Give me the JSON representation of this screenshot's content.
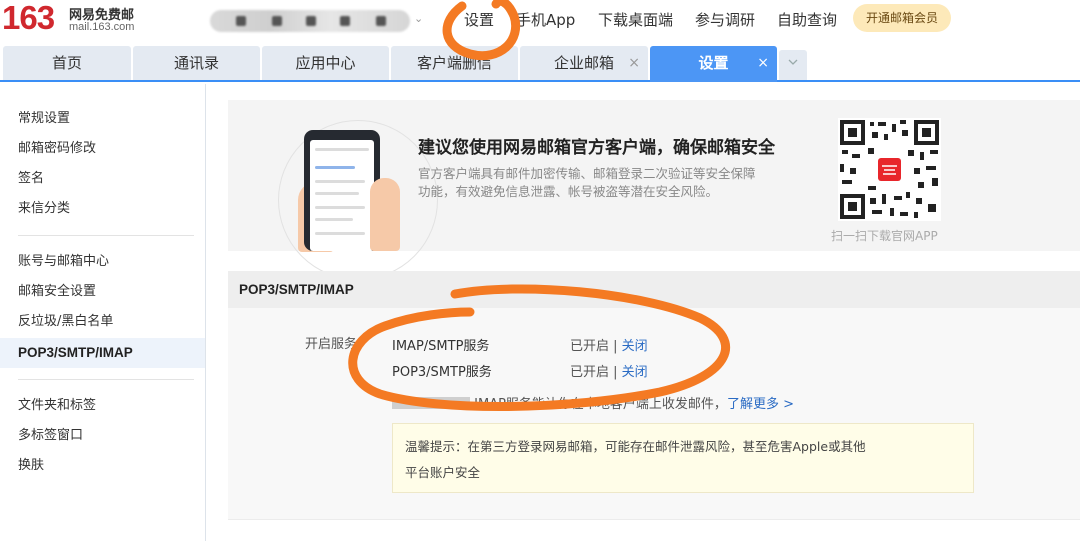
{
  "brand": {
    "number": "163",
    "name": "网易免费邮",
    "domain": "mail.163.com",
    "color": "#d0282e"
  },
  "topnav": {
    "settings": "设置",
    "mobile_app": "手机App",
    "desktop": "下载桌面端",
    "survey": "参与调研",
    "self_service": "自助查询",
    "vip": "开通邮箱会员",
    "caret": "⌄"
  },
  "tabs": [
    {
      "label": "首页"
    },
    {
      "label": "通讯录"
    },
    {
      "label": "应用中心"
    },
    {
      "label": "客户端删信"
    },
    {
      "label": "企业邮箱",
      "close": "×"
    },
    {
      "label": "设置",
      "close": "×",
      "active": true
    }
  ],
  "tab_more_icon": "chevron-down-icon",
  "sidebar": {
    "groups": [
      [
        "常规设置",
        "邮箱密码修改",
        "签名",
        "来信分类"
      ],
      [
        "账号与邮箱中心",
        "邮箱安全设置",
        "反垃圾/黑白名单",
        "POP3/SMTP/IMAP"
      ],
      [
        "文件夹和标签",
        "多标签窗口",
        "换肤"
      ]
    ],
    "active": "POP3/SMTP/IMAP"
  },
  "banner": {
    "title": "建议您使用网易邮箱官方客户端，确保邮箱安全",
    "desc": "官方客户端具有邮件加密传输、邮箱登录二次验证等安全保障功能，有效避免信息泄露、帐号被盗等潜在安全风险。",
    "qr_caption": "扫一扫下载官网APP"
  },
  "section": {
    "title": "POP3/SMTP/IMAP",
    "enable_label": "开启服务",
    "services": [
      {
        "name": "IMAP/SMTP服务",
        "status": "已开启",
        "sep": " | ",
        "action": "关闭"
      },
      {
        "name": "POP3/SMTP服务",
        "status": "已开启",
        "sep": " | ",
        "action": "关闭"
      }
    ],
    "note": "IMAP服务能让你在本地客户端上收发邮件，",
    "learn_more": "了解更多 >",
    "tip_line1": "温馨提示：在第三方登录网易邮箱，可能存在邮件泄露风险，甚至危害Apple或其他",
    "tip_line2": "平台账户安全"
  },
  "colors": {
    "accent": "#4c96f5",
    "annotation": "#f47a23",
    "link": "#2a6bc4"
  }
}
